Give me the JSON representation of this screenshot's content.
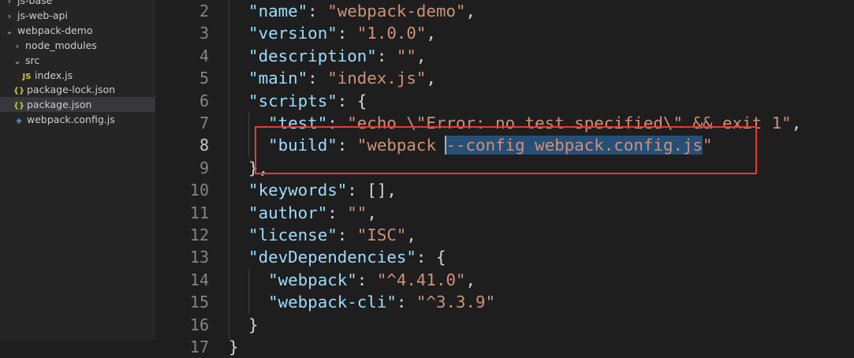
{
  "explorer": {
    "items": [
      {
        "label": "js-base",
        "chevron": "›",
        "icon": "",
        "depth": 0
      },
      {
        "label": "js-web-api",
        "chevron": "›",
        "icon": "",
        "depth": 0
      },
      {
        "label": "webpack-demo",
        "chevron": "⌄",
        "icon": "",
        "depth": 0
      },
      {
        "label": "node_modules",
        "chevron": "›",
        "icon": "",
        "depth": 1
      },
      {
        "label": "src",
        "chevron": "⌄",
        "icon": "",
        "depth": 1
      },
      {
        "label": "index.js",
        "chevron": "",
        "icon": "JS",
        "depth": 2
      },
      {
        "label": "package-lock.json",
        "chevron": "",
        "icon": "{}",
        "depth": 1
      },
      {
        "label": "package.json",
        "chevron": "",
        "icon": "{}",
        "depth": 1,
        "selected": true
      },
      {
        "label": "webpack.config.js",
        "chevron": "",
        "icon": "◈",
        "depth": 1
      }
    ]
  },
  "editor": {
    "active_line": 8,
    "lines": [
      {
        "n": "2",
        "indent": 1,
        "tokens": [
          [
            "k",
            "\"name\""
          ],
          [
            "p",
            ": "
          ],
          [
            "s",
            "\"webpack-demo\""
          ],
          [
            "p",
            ","
          ]
        ]
      },
      {
        "n": "3",
        "indent": 1,
        "tokens": [
          [
            "k",
            "\"version\""
          ],
          [
            "p",
            ": "
          ],
          [
            "s",
            "\"1.0.0\""
          ],
          [
            "p",
            ","
          ]
        ]
      },
      {
        "n": "4",
        "indent": 1,
        "tokens": [
          [
            "k",
            "\"description\""
          ],
          [
            "p",
            ": "
          ],
          [
            "s",
            "\"\""
          ],
          [
            "p",
            ","
          ]
        ]
      },
      {
        "n": "5",
        "indent": 1,
        "tokens": [
          [
            "k",
            "\"main\""
          ],
          [
            "p",
            ": "
          ],
          [
            "s",
            "\"index.js\""
          ],
          [
            "p",
            ","
          ]
        ]
      },
      {
        "n": "6",
        "indent": 1,
        "tokens": [
          [
            "k",
            "\"scripts\""
          ],
          [
            "p",
            ": {"
          ]
        ]
      },
      {
        "n": "7",
        "indent": 2,
        "tokens": [
          [
            "k",
            "\"test\""
          ],
          [
            "p",
            ": "
          ],
          [
            "s",
            "\"echo \\\"Error: no test specified\\\" && exit 1\""
          ],
          [
            "p",
            ","
          ]
        ]
      },
      {
        "n": "8",
        "indent": 2,
        "tokens": [
          [
            "k",
            "\"build\""
          ],
          [
            "p",
            ": "
          ],
          [
            "s",
            "\"webpack "
          ],
          [
            "sel",
            "--config webpack.config.js"
          ],
          [
            "s",
            "\""
          ]
        ]
      },
      {
        "n": "9",
        "indent": 1,
        "tokens": [
          [
            "p",
            "},"
          ]
        ]
      },
      {
        "n": "10",
        "indent": 1,
        "tokens": [
          [
            "k",
            "\"keywords\""
          ],
          [
            "p",
            ": [],"
          ]
        ]
      },
      {
        "n": "11",
        "indent": 1,
        "tokens": [
          [
            "k",
            "\"author\""
          ],
          [
            "p",
            ": "
          ],
          [
            "s",
            "\"\""
          ],
          [
            "p",
            ","
          ]
        ]
      },
      {
        "n": "12",
        "indent": 1,
        "tokens": [
          [
            "k",
            "\"license\""
          ],
          [
            "p",
            ": "
          ],
          [
            "s",
            "\"ISC\""
          ],
          [
            "p",
            ","
          ]
        ]
      },
      {
        "n": "13",
        "indent": 1,
        "tokens": [
          [
            "k",
            "\"devDependencies\""
          ],
          [
            "p",
            ": {"
          ]
        ]
      },
      {
        "n": "14",
        "indent": 2,
        "tokens": [
          [
            "k",
            "\"webpack\""
          ],
          [
            "p",
            ": "
          ],
          [
            "s",
            "\"^4.41.0\""
          ],
          [
            "p",
            ","
          ]
        ]
      },
      {
        "n": "15",
        "indent": 2,
        "tokens": [
          [
            "k",
            "\"webpack-cli\""
          ],
          [
            "p",
            ": "
          ],
          [
            "s",
            "\"^3.3.9\""
          ]
        ]
      },
      {
        "n": "16",
        "indent": 1,
        "tokens": [
          [
            "p",
            "}"
          ]
        ]
      },
      {
        "n": "17",
        "indent": 0,
        "tokens": [
          [
            "p",
            "}"
          ]
        ]
      }
    ]
  },
  "colors": {
    "key": "#9cdcfe",
    "string": "#ce9178",
    "highlight_box": "#e53935",
    "selection": "#264f78"
  }
}
